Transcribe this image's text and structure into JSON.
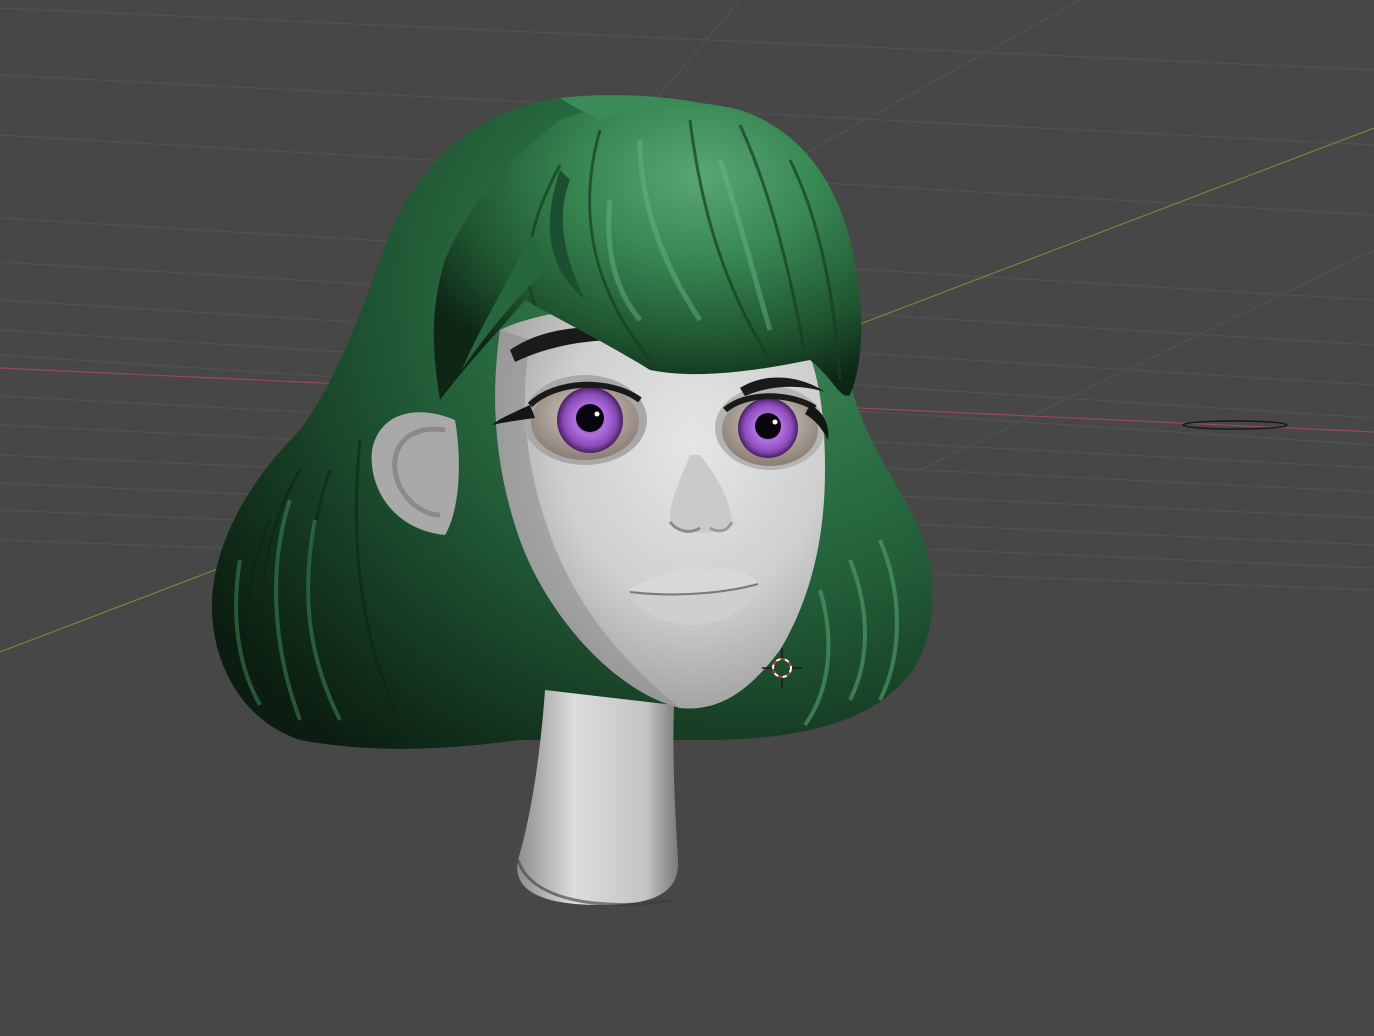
{
  "viewport": {
    "background": "#474747",
    "grid_color": "#555555",
    "x_axis_color": "#9a4a52",
    "y_axis_color": "#6e8a3a"
  },
  "model": {
    "hair_color": "#2f7d4b",
    "skin_color": "#c8c8c8",
    "iris_color": "#9a58c8"
  },
  "icons": {
    "cursor": "3d-cursor-icon",
    "origin": "object-origin-icon",
    "light": "light-gizmo-icon"
  }
}
